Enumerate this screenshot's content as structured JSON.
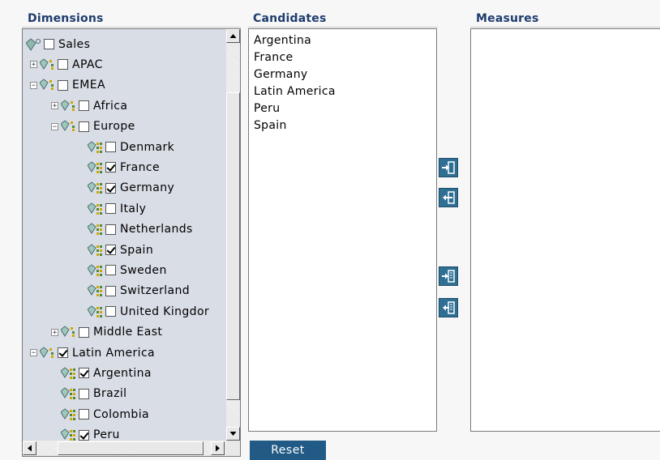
{
  "headers": {
    "dimensions": "Dimensions",
    "candidates": "Candidates",
    "measures": "Measures"
  },
  "tree": [
    {
      "label": "Sales",
      "level": 0,
      "toggle": "",
      "checked": false,
      "icon": "hierarchy-root-icon"
    },
    {
      "label": "APAC",
      "level": 1,
      "toggle": "+",
      "checked": false,
      "icon": "level-icon"
    },
    {
      "label": "EMEA",
      "level": 1,
      "toggle": "−",
      "checked": false,
      "icon": "level-icon"
    },
    {
      "label": "Africa",
      "level": 2,
      "toggle": "+",
      "checked": false,
      "icon": "level-icon"
    },
    {
      "label": "Europe",
      "level": 2,
      "toggle": "−",
      "checked": false,
      "icon": "level-icon"
    },
    {
      "label": "Denmark",
      "level": 3,
      "toggle": "",
      "checked": false,
      "icon": "member-icon"
    },
    {
      "label": "France",
      "level": 3,
      "toggle": "",
      "checked": true,
      "icon": "member-icon"
    },
    {
      "label": "Germany",
      "level": 3,
      "toggle": "",
      "checked": true,
      "icon": "member-icon"
    },
    {
      "label": "Italy",
      "level": 3,
      "toggle": "",
      "checked": false,
      "icon": "member-icon"
    },
    {
      "label": "Netherlands",
      "level": 3,
      "toggle": "",
      "checked": false,
      "icon": "member-icon"
    },
    {
      "label": "Spain",
      "level": 3,
      "toggle": "",
      "checked": true,
      "icon": "member-icon"
    },
    {
      "label": "Sweden",
      "level": 3,
      "toggle": "",
      "checked": false,
      "icon": "member-icon"
    },
    {
      "label": "Switzerland",
      "level": 3,
      "toggle": "",
      "checked": false,
      "icon": "member-icon"
    },
    {
      "label": "United Kingdor",
      "level": 3,
      "toggle": "",
      "checked": false,
      "icon": "member-icon"
    },
    {
      "label": "Middle East",
      "level": 2,
      "toggle": "+",
      "checked": false,
      "icon": "level-icon"
    },
    {
      "label": "Latin America",
      "level": 1,
      "toggle": "−",
      "checked": true,
      "icon": "level-icon"
    },
    {
      "label": "Argentina",
      "level": 2,
      "toggle": "",
      "checked": true,
      "icon": "member-icon"
    },
    {
      "label": "Brazil",
      "level": 2,
      "toggle": "",
      "checked": false,
      "icon": "member-icon"
    },
    {
      "label": "Colombia",
      "level": 2,
      "toggle": "",
      "checked": false,
      "icon": "member-icon"
    },
    {
      "label": "Peru",
      "level": 2,
      "toggle": "",
      "checked": true,
      "icon": "member-icon"
    }
  ],
  "candidates": [
    "Argentina",
    "France",
    "Germany",
    "Latin America",
    "Peru",
    "Spain"
  ],
  "measures": [],
  "buttons": {
    "add": "add-to-measures-icon",
    "remove": "remove-from-measures-icon",
    "add_all": "add-all-icon",
    "remove_all": "remove-all-icon",
    "reset_label": "Reset"
  },
  "colors": {
    "header_text": "#1e3c6e",
    "tree_bg": "#d9dde6",
    "button_bg": "#2f6f94",
    "reset_bg": "#215b85"
  }
}
